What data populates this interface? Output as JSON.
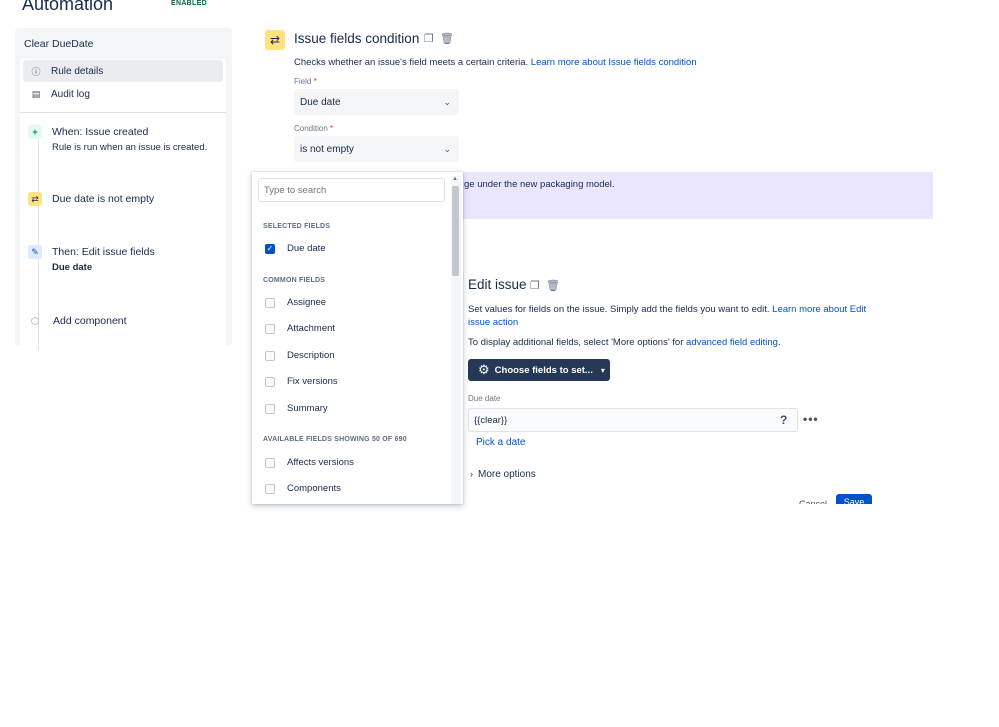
{
  "app": {
    "title": "Automation",
    "status": "ENABLED"
  },
  "sidebar": {
    "rule_name": "Clear DueDate",
    "nav": [
      {
        "label": "Rule details",
        "icon": "info-icon"
      },
      {
        "label": "Audit log",
        "icon": "document-icon"
      }
    ],
    "steps": [
      {
        "title": "When: Issue created",
        "subtitle": "Rule is run when an issue is created.",
        "icon": "plus-icon"
      },
      {
        "title": "Due date is not empty",
        "icon": "shuffle-icon"
      },
      {
        "title": "Then: Edit issue fields",
        "subtitle": "Due date",
        "icon": "pencil-icon"
      }
    ],
    "add_component": "Add component"
  },
  "condition": {
    "title": "Issue fields condition",
    "description": "Checks whether an issue's field meets a certain criteria.",
    "learn_more": "Learn more about Issue fields condition",
    "field_label": "Field",
    "field_value": "Due date",
    "condition_label": "Condition",
    "condition_value": "is not empty"
  },
  "banner": {
    "text": "ge under the new packaging model."
  },
  "edit_issue": {
    "title": "Edit issue",
    "description": "Set values for fields on the issue. Simply add the fields you want to edit.",
    "learn_more_1": "Learn more about Edit",
    "learn_more_2": "issue action",
    "additional_text": "To display additional fields, select 'More options' for",
    "additional_link": "advanced field editing",
    "choose_button": "Choose fields to set...",
    "due_label": "Due date",
    "due_value": "{{clear}}",
    "help": "?",
    "more": "•••",
    "pick_date": "Pick a date",
    "more_options": "More options",
    "cancel": "Cancel",
    "save": "Save"
  },
  "dropdown": {
    "search_placeholder": "Type to search",
    "selected_heading": "SELECTED FIELDS",
    "selected": [
      {
        "label": "Due date",
        "checked": true
      }
    ],
    "common_heading": "COMMON FIELDS",
    "common": [
      {
        "label": "Assignee"
      },
      {
        "label": "Attachment"
      },
      {
        "label": "Description"
      },
      {
        "label": "Fix versions"
      },
      {
        "label": "Summary"
      }
    ],
    "available_heading": "AVAILABLE FIELDS SHOWING 50 OF 690",
    "available": [
      {
        "label": "Affects versions"
      },
      {
        "label": "Components"
      }
    ]
  }
}
